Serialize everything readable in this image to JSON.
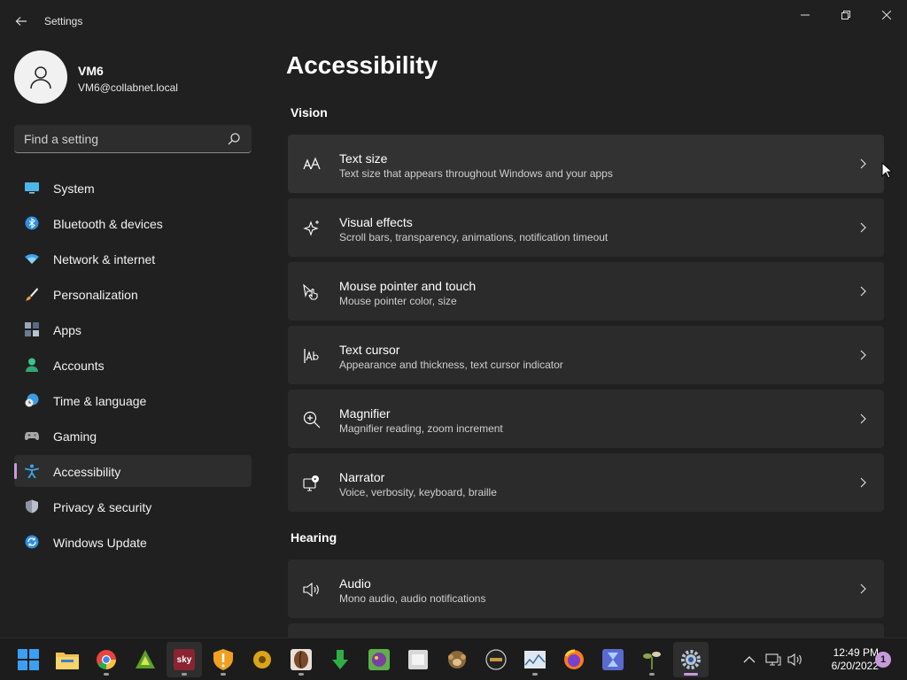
{
  "app": {
    "title": "Settings"
  },
  "user": {
    "name": "VM6",
    "email": "VM6@collabnet.local"
  },
  "search": {
    "placeholder": "Find a setting"
  },
  "nav": {
    "items": [
      {
        "label": "System",
        "icon": "monitor-icon"
      },
      {
        "label": "Bluetooth & devices",
        "icon": "bluetooth-icon"
      },
      {
        "label": "Network & internet",
        "icon": "wifi-icon"
      },
      {
        "label": "Personalization",
        "icon": "brush-icon"
      },
      {
        "label": "Apps",
        "icon": "apps-icon"
      },
      {
        "label": "Accounts",
        "icon": "person-icon"
      },
      {
        "label": "Time & language",
        "icon": "clock-globe-icon"
      },
      {
        "label": "Gaming",
        "icon": "gamepad-icon"
      },
      {
        "label": "Accessibility",
        "icon": "accessibility-icon",
        "active": true
      },
      {
        "label": "Privacy & security",
        "icon": "shield-icon"
      },
      {
        "label": "Windows Update",
        "icon": "update-icon"
      }
    ]
  },
  "main": {
    "title": "Accessibility",
    "sections": [
      {
        "title": "Vision",
        "cards": [
          {
            "title": "Text size",
            "desc": "Text size that appears throughout Windows and your apps",
            "icon": "text-size-icon"
          },
          {
            "title": "Visual effects",
            "desc": "Scroll bars, transparency, animations, notification timeout",
            "icon": "sparkle-icon"
          },
          {
            "title": "Mouse pointer and touch",
            "desc": "Mouse pointer color, size",
            "icon": "pointer-touch-icon"
          },
          {
            "title": "Text cursor",
            "desc": "Appearance and thickness, text cursor indicator",
            "icon": "text-cursor-icon"
          },
          {
            "title": "Magnifier",
            "desc": "Magnifier reading, zoom increment",
            "icon": "magnifier-icon"
          },
          {
            "title": "Narrator",
            "desc": "Voice, verbosity, keyboard, braille",
            "icon": "narrator-icon"
          }
        ]
      },
      {
        "title": "Hearing",
        "cards": [
          {
            "title": "Audio",
            "desc": "Mono audio, audio notifications",
            "icon": "speaker-icon"
          }
        ]
      }
    ]
  },
  "taskbar": {
    "apps": [
      {
        "name": "start",
        "glyph": "",
        "color": "#3aa0f3"
      },
      {
        "name": "file-explorer",
        "glyph": "",
        "color": "#f2c14e"
      },
      {
        "name": "chrome",
        "glyph": "",
        "color": "#e8453c"
      },
      {
        "name": "app-green-triangle",
        "glyph": "",
        "color": "#5aa02c"
      },
      {
        "name": "sky-app",
        "glyph": "sky",
        "color": "#8a2432"
      },
      {
        "name": "shield-app",
        "glyph": "",
        "color": "#f0a020"
      },
      {
        "name": "app-yellow",
        "glyph": "",
        "color": "#d9a418"
      },
      {
        "name": "app-brown",
        "glyph": "",
        "color": "#7a4a2a"
      },
      {
        "name": "app-download",
        "glyph": "",
        "color": "#2fae46"
      },
      {
        "name": "app-purple",
        "glyph": "",
        "color": "#7b3fa0"
      },
      {
        "name": "app-white",
        "glyph": "",
        "color": "#d8d8d8"
      },
      {
        "name": "app-monkey",
        "glyph": "",
        "color": "#8a6a3a"
      },
      {
        "name": "app-dark-circle",
        "glyph": "",
        "color": "#3a3a3a"
      },
      {
        "name": "app-chart",
        "glyph": "",
        "color": "#5f86b0"
      },
      {
        "name": "firefox",
        "glyph": "",
        "color": "#ff7a1a"
      },
      {
        "name": "app-hourglass",
        "glyph": "",
        "color": "#5a6ad0"
      },
      {
        "name": "app-plant",
        "glyph": "",
        "color": "#6b8a3a"
      },
      {
        "name": "settings",
        "glyph": "",
        "color": "#4a6a9a"
      }
    ],
    "clock": {
      "time": "12:49 PM",
      "date": "6/20/2022"
    },
    "notifications": "1"
  }
}
